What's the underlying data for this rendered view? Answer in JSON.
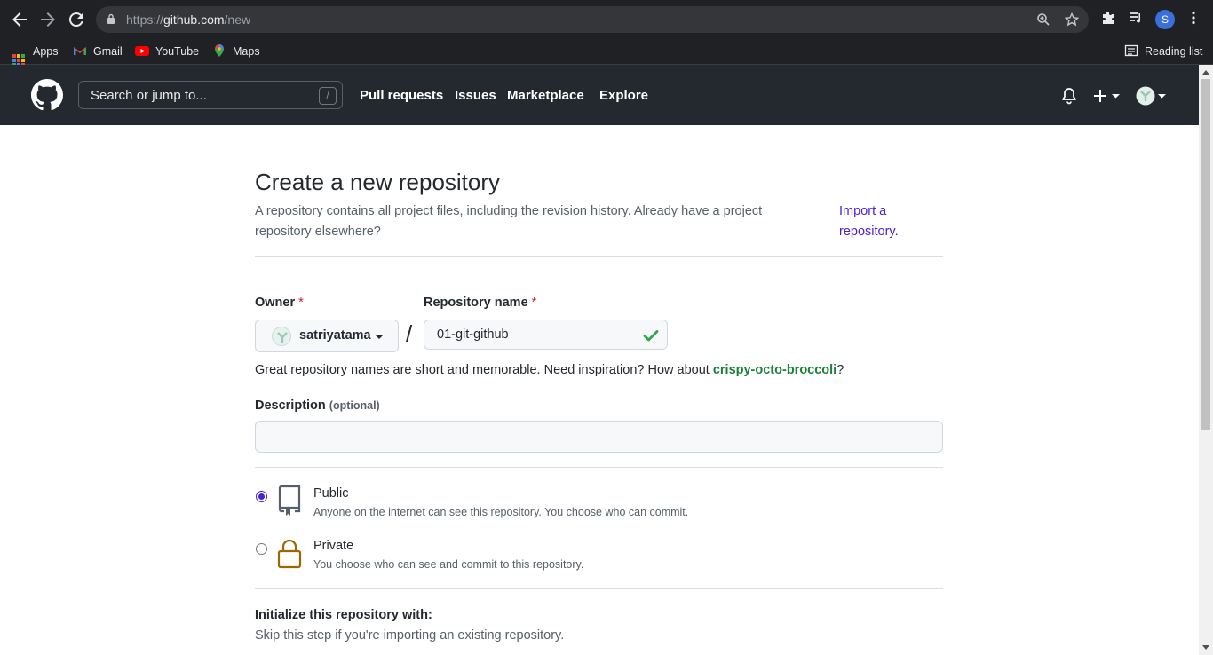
{
  "browser": {
    "url_prefix": "https://",
    "url_host": "github.com",
    "url_path": "/new",
    "profile_initial": "S",
    "bookmarks": [
      {
        "label": "Apps",
        "icon": "apps-grid-icon"
      },
      {
        "label": "Gmail",
        "icon": "gmail-icon"
      },
      {
        "label": "YouTube",
        "icon": "youtube-icon"
      },
      {
        "label": "Maps",
        "icon": "maps-icon"
      }
    ],
    "reading_list": "Reading list"
  },
  "header": {
    "search_placeholder": "Search or jump to...",
    "search_shortcut": "/",
    "nav": [
      "Pull requests",
      "Issues",
      "Marketplace",
      "Explore"
    ]
  },
  "page": {
    "title": "Create a new repository",
    "subtitle": "A repository contains all project files, including the revision history. Already have a project repository elsewhere?",
    "import_link": "Import a repository.",
    "owner_label": "Owner",
    "required_mark": "*",
    "owner_value": "satriyatama",
    "separator": "/",
    "repo_label": "Repository name",
    "repo_value": "01-git-github",
    "hint_text": "Great repository names are short and memorable. Need inspiration? How about ",
    "hint_suggestion": "crispy-octo-broccoli",
    "hint_end": "?",
    "description_label": "Description",
    "description_optional": "(optional)",
    "description_value": "",
    "visibility": [
      {
        "title": "Public",
        "desc": "Anyone on the internet can see this repository. You choose who can commit.",
        "checked": true
      },
      {
        "title": "Private",
        "desc": "You choose who can see and commit to this repository.",
        "checked": false
      }
    ],
    "init_title": "Initialize this repository with:",
    "init_desc": "Skip this step if you're importing an existing repository."
  },
  "colors": {
    "header_bg": "#24292f",
    "link": "#4a22d6",
    "success": "#1a7f37",
    "required": "#cf222e",
    "private_icon": "#9a6700"
  }
}
